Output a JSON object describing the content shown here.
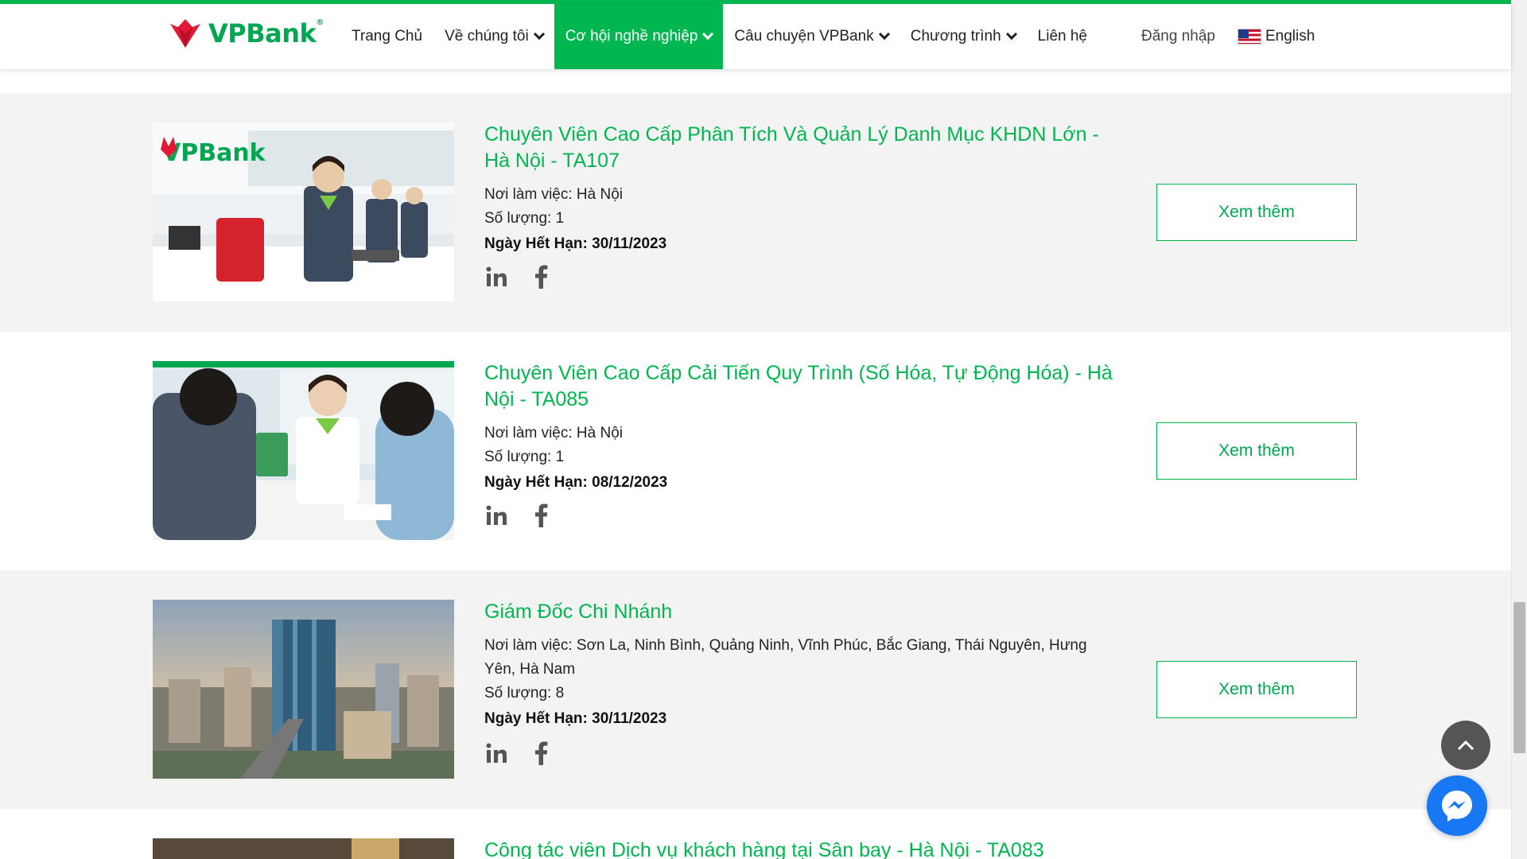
{
  "brand": {
    "name": "VPBank",
    "logo_text": "VPBank",
    "accent": "#00b74f",
    "red": "#e31837"
  },
  "nav": {
    "items": [
      {
        "label": "Trang Chủ",
        "dropdown": false,
        "active": false
      },
      {
        "label": "Về chúng tôi",
        "dropdown": true,
        "active": false
      },
      {
        "label": "Cơ hội nghề nghiệp",
        "dropdown": true,
        "active": true
      },
      {
        "label": "Câu chuyện VPBank",
        "dropdown": true,
        "active": false
      },
      {
        "label": "Chương trình",
        "dropdown": true,
        "active": false
      },
      {
        "label": "Liên hệ",
        "dropdown": false,
        "active": false
      }
    ],
    "login": "Đăng nhập",
    "language": "English",
    "language_icon": "us-flag-icon"
  },
  "jobs": [
    {
      "title": "Chuyên Viên Cao Cấp Phân Tích Và Quản Lý Danh Mục KHDN Lớn - Hà Nội - TA107",
      "location": "Nơi làm việc: Hà Nội",
      "quantity": "Số lượng: 1",
      "expiry": "Ngày Hết Hạn: 30/11/2023",
      "button": "Xem thêm",
      "image": "bank-counter-staff-image"
    },
    {
      "title": "Chuyên Viên Cao Cấp Cải Tiến Quy Trình (Số Hóa, Tự Động Hóa) - Hà Nội - TA085",
      "location": "Nơi làm việc: Hà Nội",
      "quantity": "Số lượng: 1",
      "expiry": "Ngày Hết Hạn: 08/12/2023",
      "button": "Xem thêm",
      "image": "customer-consultation-image"
    },
    {
      "title": "Giám Đốc Chi Nhánh",
      "location": "Nơi làm việc: Sơn La, Ninh Bình, Quảng Ninh, Vĩnh Phúc, Bắc Giang, Thái Nguyên, Hưng Yên, Hà Nam",
      "quantity": "Số lượng: 8",
      "expiry": "Ngày Hết Hạn: 30/11/2023",
      "button": "Xem thêm",
      "image": "vpbank-tower-city-image"
    },
    {
      "title": "Công tác viên Dịch vụ khách hàng tại Sân bay - Hà Nội - TA083",
      "image": "diamond-lounge-image"
    }
  ],
  "social_icons": [
    "linkedin-icon",
    "facebook-icon"
  ],
  "floating": {
    "scroll_top_icon": "chevron-up-icon",
    "chat_icon": "messenger-icon"
  }
}
